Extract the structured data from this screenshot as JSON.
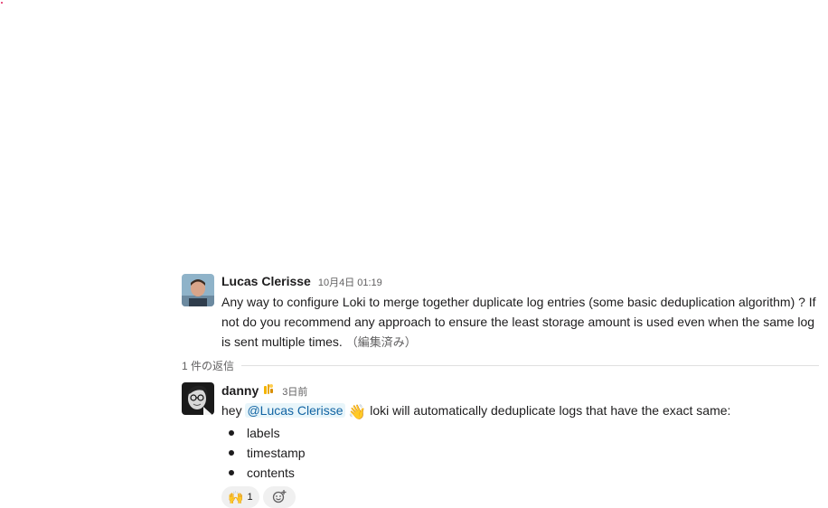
{
  "messages": [
    {
      "author": "Lucas Clerisse",
      "timestamp": "10月4日 01:19",
      "text": "Any way to configure Loki to merge together duplicate log entries (some basic deduplication algorithm) ? If not do you recommend any approach to ensure the least storage amount is used even when the same log is sent multiple times.",
      "edited": "（編集済み）"
    }
  ],
  "thread": {
    "reply_count_label": "1 件の返信"
  },
  "reply": {
    "author": "danny",
    "timestamp": "3日前",
    "text_prefix": "hey",
    "mention": "@Lucas Clerisse",
    "emoji": "👋",
    "text_suffix": "loki will automatically deduplicate logs that have the exact same:",
    "bullets": [
      "labels",
      "timestamp",
      "contents"
    ],
    "reactions": [
      {
        "emoji": "🙌",
        "count": "1"
      }
    ],
    "add_reaction_icon": "add-reaction-icon"
  },
  "colors": {
    "mention_bg": "#e8f5fa",
    "mention_text": "#1264a3",
    "meta_text": "#616061"
  }
}
